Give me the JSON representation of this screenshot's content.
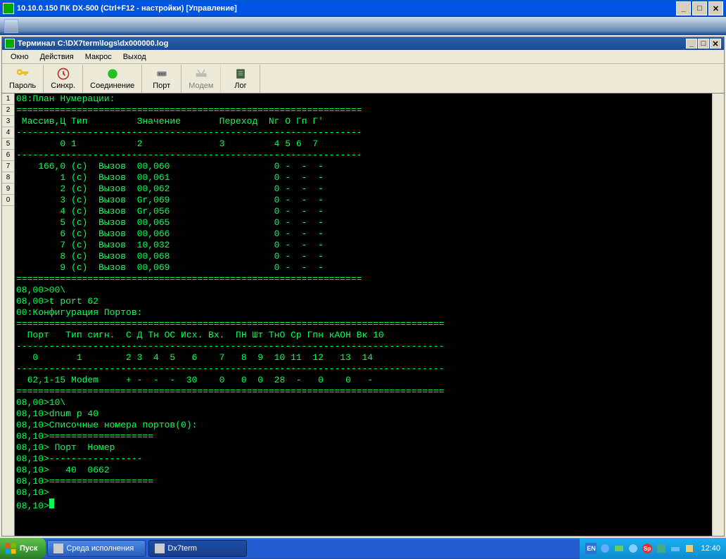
{
  "outer": {
    "title": "10.10.0.150 ПК DX-500      (Ctrl+F12 - настройки) [Управление]"
  },
  "inner": {
    "title": "Терминал C:\\DX7term\\logs\\dx000000.log"
  },
  "menu": {
    "okno": "Окно",
    "deystviya": "Действия",
    "makros": "Макрос",
    "vyhod": "Выход"
  },
  "toolbar": {
    "parol": "Пароль",
    "sinhr": "Синхр.",
    "soedinenie": "Соединение",
    "port": "Порт",
    "modem": "Модем",
    "log": "Лог"
  },
  "gutter": [
    "1",
    "2",
    "3",
    "4",
    "5",
    "6",
    "7",
    "8",
    "9",
    "0"
  ],
  "terminal": {
    "lines": [
      "08:План Нумерации:",
      "===============================================================",
      " Массив,Ц Тип         Значение       Переход  Nг O Гп Г'",
      "---------------------------------------------------------------",
      "        0 1           2              3         4 5 6  7",
      "---------------------------------------------------------------",
      "    166,0 (c)  Вызов  00,060                   0 -  -  -",
      "        1 (c)  Вызов  00,061                   0 -  -  -",
      "        2 (c)  Вызов  00,062                   0 -  -  -",
      "        3 (c)  Вызов  Gr,069                   0 -  -  -",
      "        4 (c)  Вызов  Gr,056                   0 -  -  -",
      "        5 (c)  Вызов  00,065                   0 -  -  -",
      "        6 (c)  Вызов  00,066                   0 -  -  -",
      "        7 (c)  Вызов  10,032                   0 -  -  -",
      "        8 (c)  Вызов  00,068                   0 -  -  -",
      "        9 (c)  Вызов  00,069                   0 -  -  -",
      "===============================================================",
      "08,00>00\\",
      "08,00>t port 62",
      "00:Конфигурация Портов:",
      "==============================================================================",
      "  Порт   Тип сигн.  С Д Тн ОС Исх. Вх.  ПН Шт ТнО Ср Гпн кАОН Вк 10",
      "------------------------------------------------------------------------------",
      "   0       1        2 3  4  5   6    7   8  9  10 11  12   13  14",
      "------------------------------------------------------------------------------",
      "  62,1-15 Modem     + -  -  -  30    0   0  0  28  -   0    0   -",
      "==============================================================================",
      "08,00>10\\",
      "08,10>dnum p 40",
      "08,10>Списочные номера портов(0):",
      "08,10>===================",
      "08,10> Порт  Номер",
      "08,10>-----------------",
      "08,10>   40  0662",
      "08,10>===================",
      "08,10>",
      "08,10>"
    ]
  },
  "taskbar": {
    "start": "Пуск",
    "task1": "Среда исполнения",
    "task2": "Dx7term",
    "lang": "EN",
    "clock": "12:40"
  }
}
